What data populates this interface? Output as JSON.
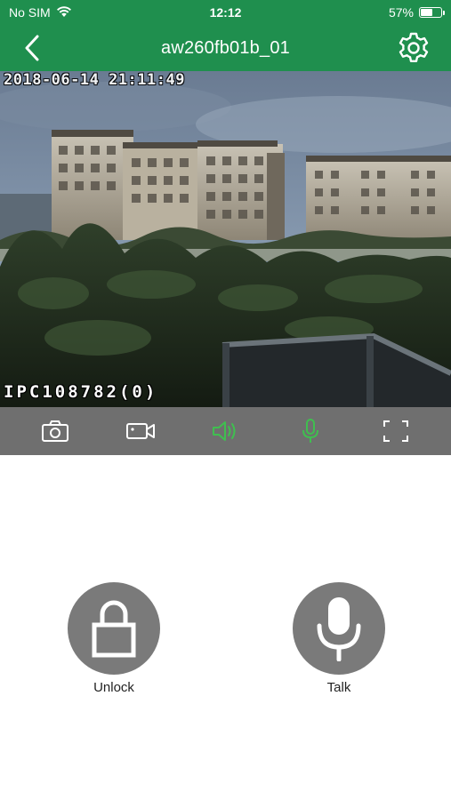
{
  "status_bar": {
    "carrier": "No SIM",
    "time": "12:12",
    "battery_percent": "57%",
    "battery_level": 0.57
  },
  "header": {
    "title": "aw260fb01b_01",
    "accent_color": "#1f8f4e"
  },
  "video": {
    "timestamp_overlay": "2018-06-14 21:11:49",
    "camera_overlay": "IPC108782(0)"
  },
  "controls": {
    "icons": [
      "camera-icon",
      "video-record-icon",
      "speaker-icon",
      "microphone-icon",
      "fullscreen-icon"
    ],
    "active_color": "#3fbf4f",
    "inactive_color": "#ffffff"
  },
  "actions": {
    "unlock_label": "Unlock",
    "talk_label": "Talk"
  }
}
